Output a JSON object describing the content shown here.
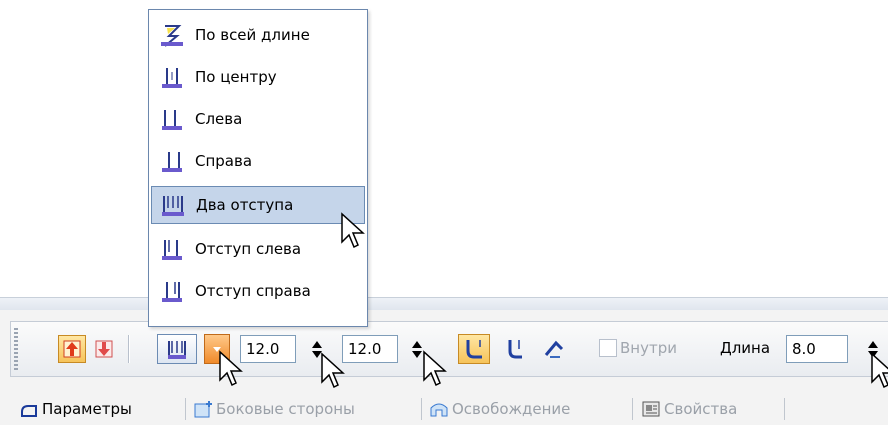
{
  "menu": {
    "items": [
      {
        "label": "По всей длине",
        "icon": "full-length-icon"
      },
      {
        "label": "По центру",
        "icon": "center-icon"
      },
      {
        "label": "Слева",
        "icon": "left-icon"
      },
      {
        "label": "Справа",
        "icon": "right-icon"
      },
      {
        "label": "Два отступа",
        "icon": "two-offsets-icon",
        "highlighted": true
      },
      {
        "label": "Отступ слева",
        "icon": "offset-left-icon"
      },
      {
        "label": "Отступ справа",
        "icon": "offset-right-icon"
      }
    ]
  },
  "toolbar": {
    "value1": "12.0",
    "value2": "12.0",
    "inside_label": "Внутри",
    "length_label": "Длина",
    "length_value": "8.0"
  },
  "tabs": [
    {
      "label": "Параметры",
      "active": true
    },
    {
      "label": "Боковые стороны",
      "active": false
    },
    {
      "label": "Освобождение",
      "active": false
    },
    {
      "label": "Свойства",
      "active": false
    }
  ],
  "colors": {
    "accent_orange": "#f08a2a",
    "highlight": "#c5d5ea",
    "border_blue": "#6b87ad"
  }
}
